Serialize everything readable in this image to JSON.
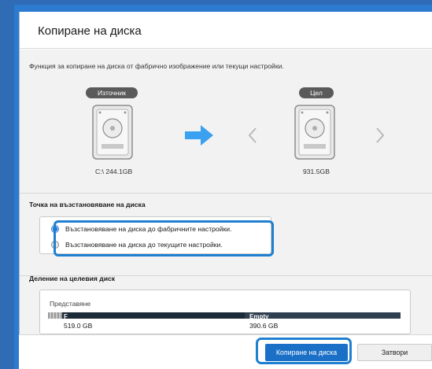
{
  "dialog": {
    "title": "Копиране на диска",
    "description": "Функция за копиране на диска от фабрично изображение или текущи настройки."
  },
  "source": {
    "pill": "Източник",
    "drive_label": "C:\\ 244.1GB"
  },
  "target": {
    "pill": "Цел",
    "drive_label": "931.5GB"
  },
  "icons": {
    "arrow": "arrow-right-icon",
    "prev": "chevron-left-icon",
    "next": "chevron-right-icon",
    "drive": "hard-drive-icon"
  },
  "restore": {
    "title": "Точка на възстановяване на диска",
    "options": [
      {
        "label": "Възстановяване на диска до фабричните настройки.",
        "selected": true
      },
      {
        "label": "Възстановяване на диска до текущите настройки.",
        "selected": false
      }
    ]
  },
  "partition": {
    "title": "Деление на целевия диск",
    "view_label": "Представяне",
    "segments": [
      {
        "name": "F",
        "size": "519.0 GB"
      },
      {
        "name": "Empty",
        "size": "390.6 GB"
      }
    ]
  },
  "footer": {
    "copy_button": "Копиране на диска",
    "close_button": "Затвори"
  },
  "colors": {
    "accent": "#1a6fc7",
    "highlight": "#1f7fd0",
    "frame": "#2d7bd0",
    "arrow": "#3aa0f0"
  }
}
